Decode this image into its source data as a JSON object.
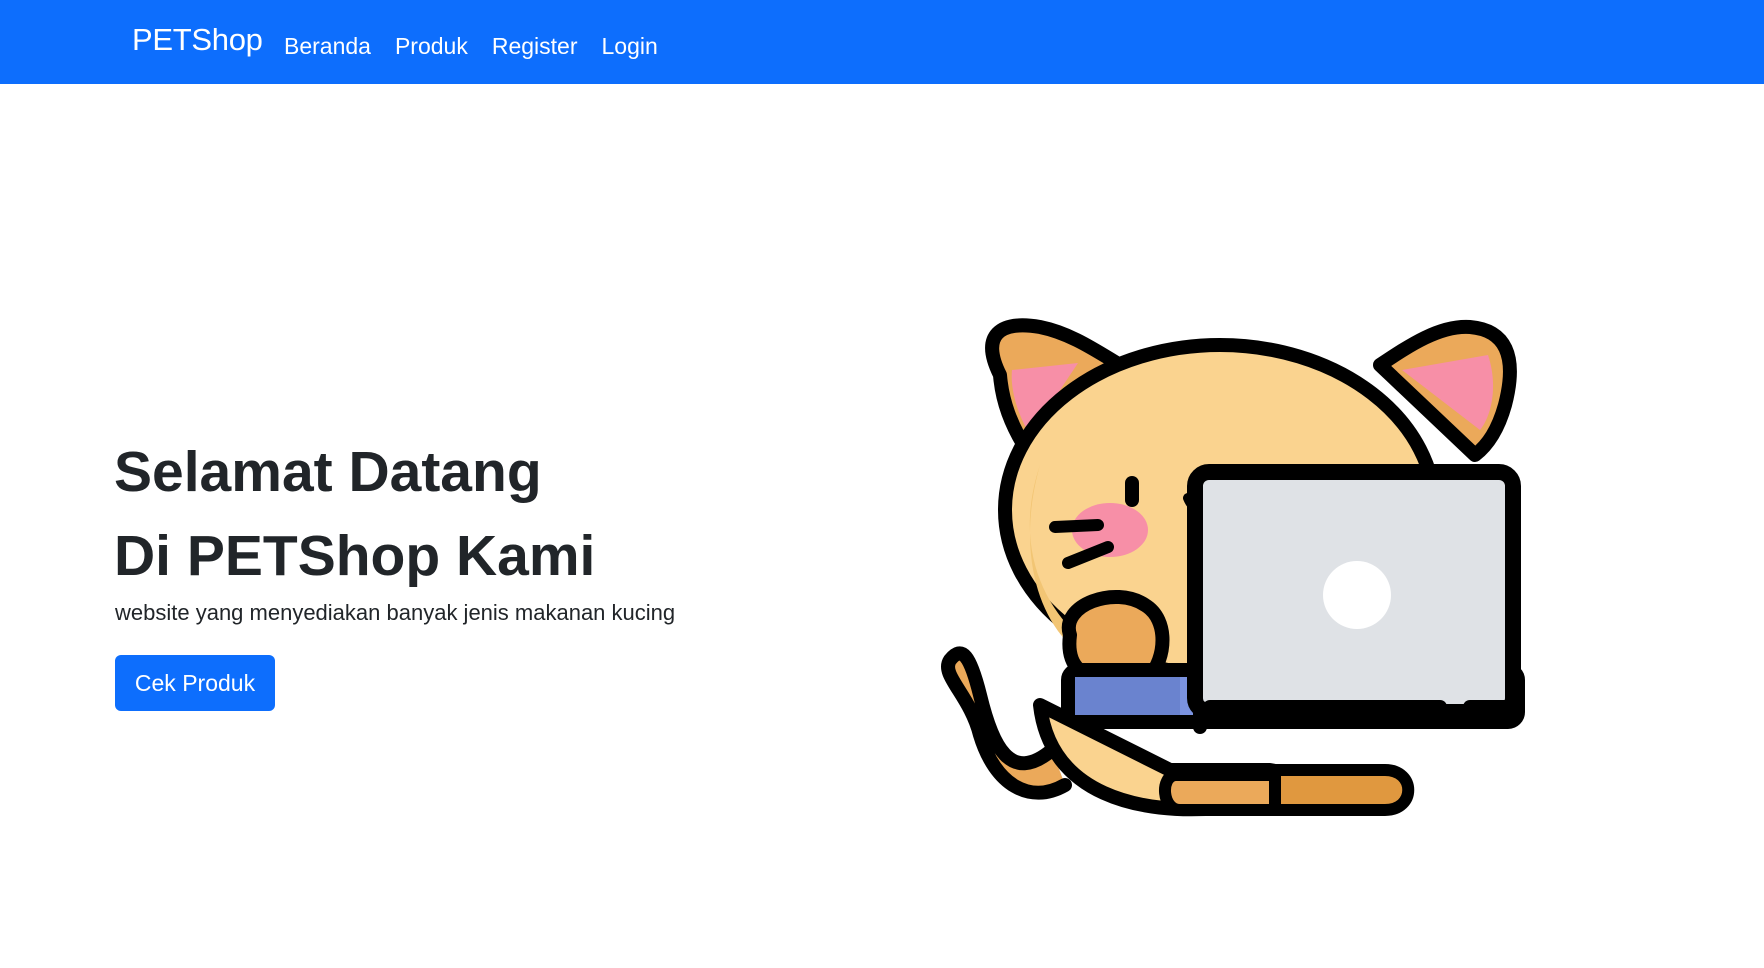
{
  "nav": {
    "brand": "PETShop",
    "links": [
      "Beranda",
      "Produk",
      "Register",
      "Login"
    ]
  },
  "hero": {
    "title_line1": "Selamat Datang",
    "title_line2": "Di PETShop Kami",
    "subtitle": "website yang menyediakan banyak jenis makanan kucing",
    "cta_label": "Cek Produk"
  },
  "illustration": {
    "icon": "cat-with-laptop-illustration"
  },
  "colors": {
    "primary": "#0d6efd",
    "text": "#212529",
    "background": "#ffffff"
  }
}
